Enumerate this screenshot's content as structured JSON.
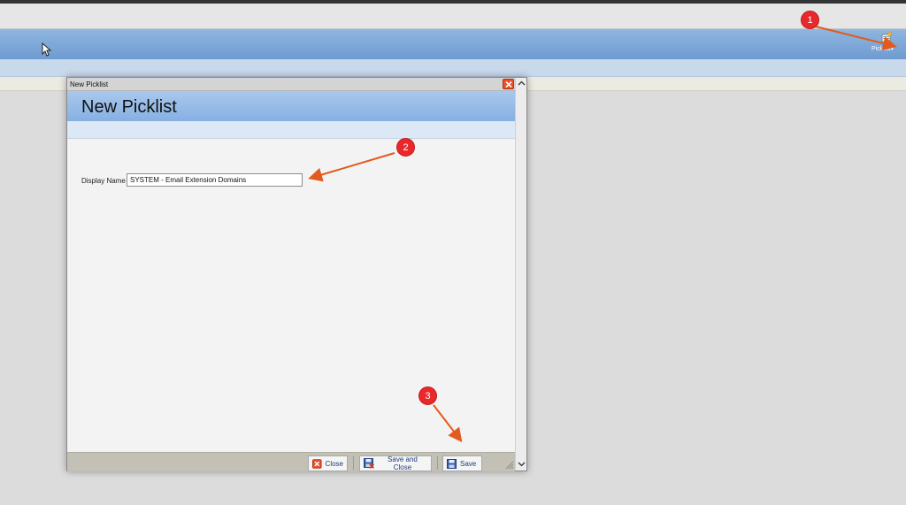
{
  "app": {
    "menu_label": "Picklist"
  },
  "dialog": {
    "window_title": "New Picklist",
    "heading": "New Picklist",
    "display_name_label": "Display Name",
    "display_name_value": "SYSTEM - Email Extension Domains",
    "buttons": {
      "close": "Close",
      "save_and_close": "Save and Close",
      "save": "Save"
    }
  },
  "annotations": {
    "step1": "1",
    "step2": "2",
    "step3": "3"
  },
  "colors": {
    "header_blue": "#7ea8d8",
    "annotation_red": "#e8292b",
    "arrow_orange": "#e35a1e"
  }
}
